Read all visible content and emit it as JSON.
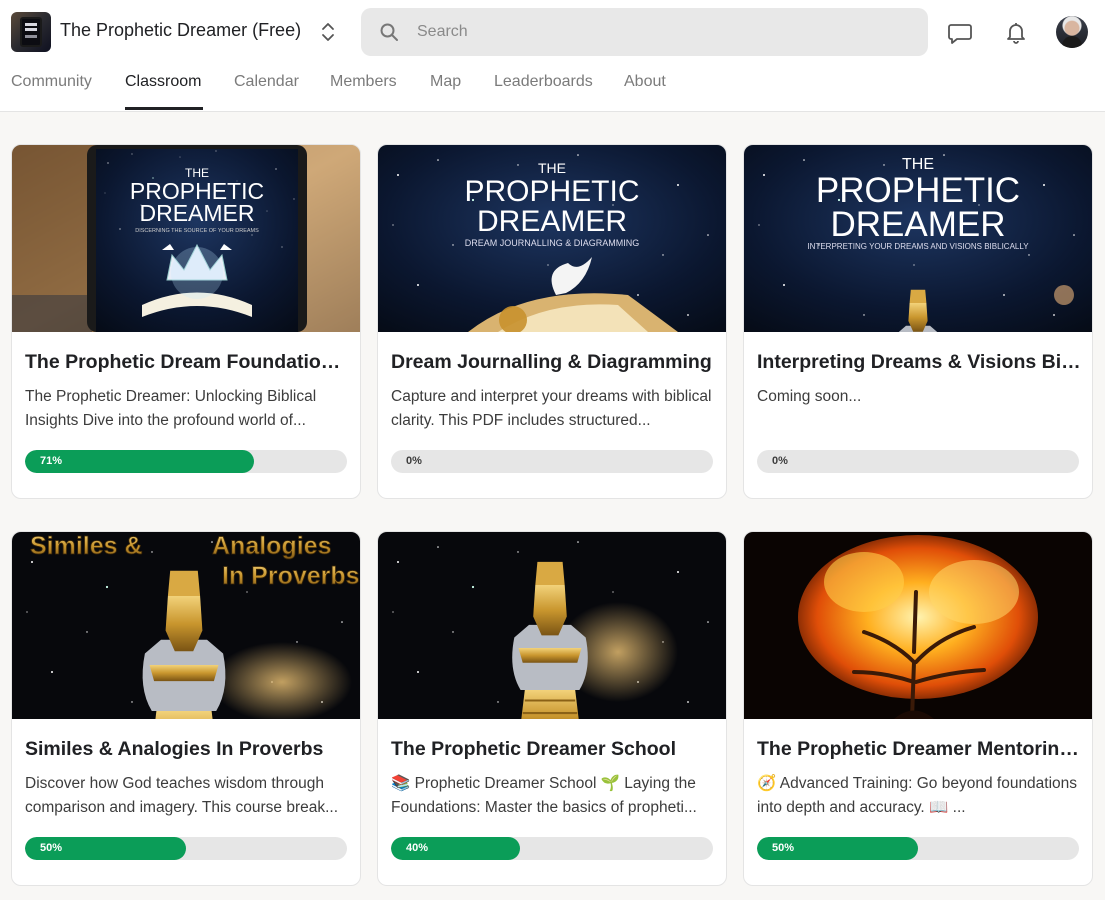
{
  "header": {
    "title": "The Prophetic Dreamer (Free)",
    "search_placeholder": "Search",
    "icons": {
      "logo": "tablet-book-logo",
      "switch": "chevron-up-down-icon",
      "search": "search-icon",
      "chat": "chat-bubble-icon",
      "notifications": "bell-icon",
      "avatar": "user-avatar"
    }
  },
  "tabs": [
    {
      "label": "Community",
      "active": false
    },
    {
      "label": "Classroom",
      "active": true
    },
    {
      "label": "Calendar",
      "active": false
    },
    {
      "label": "Members",
      "active": false
    },
    {
      "label": "Map",
      "active": false
    },
    {
      "label": "Leaderboards",
      "active": false
    },
    {
      "label": "About",
      "active": false
    }
  ],
  "colors": {
    "progress_fill": "#0b9d58",
    "progress_track": "#e6e6e6",
    "page_background": "#f8f7f5",
    "text_primary": "#202124"
  },
  "courses": [
    {
      "title": "The Prophetic Dream Foundations...",
      "description": "The Prophetic Dreamer: Unlocking Biblical Insights Dive into the profound world of...",
      "progress": 71,
      "progress_label": "71%",
      "thumbnail": {
        "kind": "tablet",
        "top": "THE",
        "line1": "PROPHETIC",
        "line2": "DREAMER",
        "subtitle": "DISCERNING THE SOURCE OF YOUR DREAMS"
      }
    },
    {
      "title": "Dream Journalling & Diagramming",
      "description": "Capture and interpret your dreams with biblical clarity. This PDF includes structured...",
      "progress": 0,
      "progress_label": "0%",
      "thumbnail": {
        "kind": "cover-dove",
        "top": "THE",
        "line1": "PROPHETIC",
        "line2": "DREAMER",
        "subtitle": "DREAM JOURNALLING & DIAGRAMMING"
      }
    },
    {
      "title": "Interpreting Dreams & Visions Bib...",
      "description": "Coming soon...",
      "progress": 0,
      "progress_label": "0%",
      "thumbnail": {
        "kind": "cover-statue",
        "top": "THE",
        "line1": "PROPHETIC",
        "line2": "DREAMER",
        "subtitle": "INTERPRETING YOUR DREAMS AND VISIONS BIBLICALLY"
      }
    },
    {
      "title": "Similes & Analogies In Proverbs",
      "description": "Discover how God teaches wisdom through comparison and imagery. This course break...",
      "progress": 50,
      "progress_label": "50%",
      "thumbnail": {
        "kind": "similes",
        "line1": "Similes &",
        "line2": "Analogies",
        "line3": "In Proverbs"
      }
    },
    {
      "title": "The Prophetic Dreamer School",
      "description": "📚 Prophetic Dreamer School 🌱 Laying the Foundations: Master the basics of propheti...",
      "progress": 40,
      "progress_label": "40%",
      "thumbnail": {
        "kind": "statue"
      }
    },
    {
      "title": "The Prophetic Dreamer Mentoring...",
      "description": "🧭 Advanced Training: Go beyond foundations into depth and accuracy. 📖 ...",
      "progress": 50,
      "progress_label": "50%",
      "thumbnail": {
        "kind": "tree"
      }
    }
  ]
}
